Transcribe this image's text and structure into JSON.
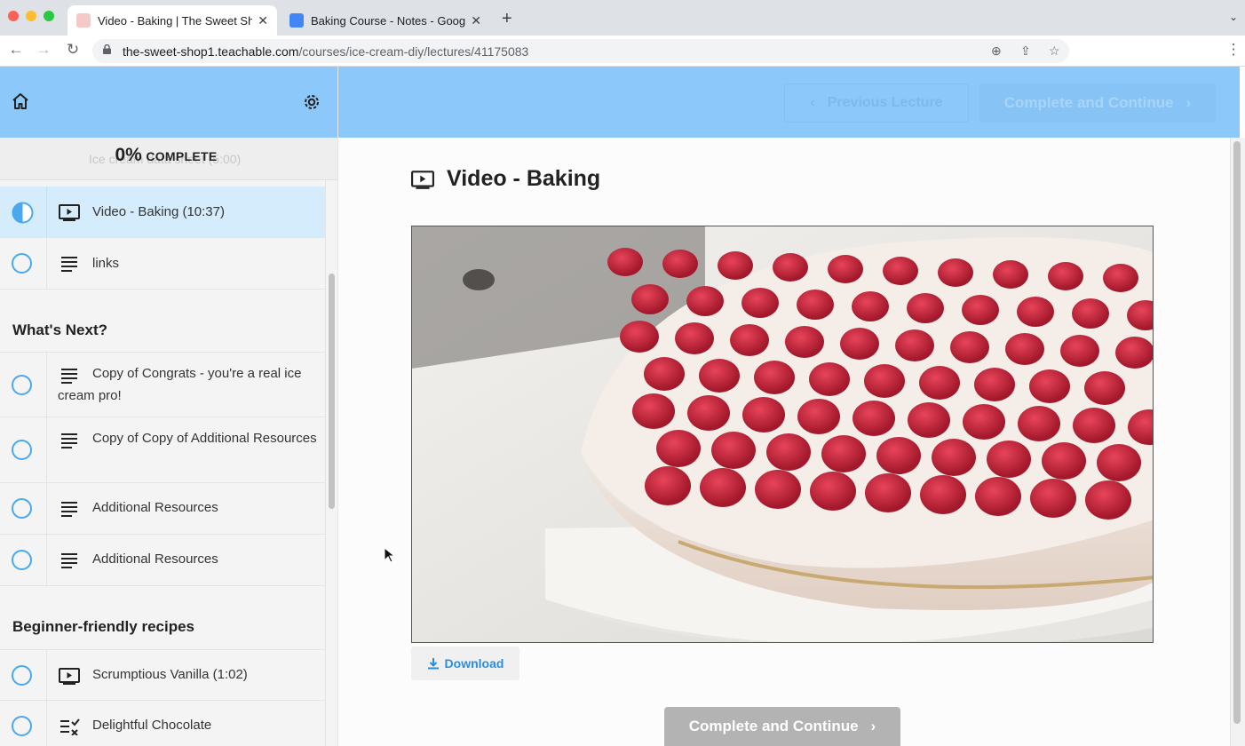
{
  "browser": {
    "tabs": [
      {
        "title": "Video - Baking | The Sweet Sh",
        "active": true
      },
      {
        "title": "Baking Course - Notes - Googl",
        "active": false
      }
    ],
    "url_domain": "the-sweet-shop1.teachable.com",
    "url_path": "/courses/ice-cream-diy/lectures/41175083"
  },
  "sidebar": {
    "progress_percent": "0%",
    "progress_label": "COMPLETE",
    "hidden_item": "Ice cream data sheet (5:00)",
    "items_top": [
      {
        "title": "Video - Baking (10:37)",
        "icon": "video-icon",
        "status": "in-progress"
      },
      {
        "title": "links",
        "icon": "text-icon",
        "status": "incomplete"
      }
    ],
    "section1": {
      "title": "What's Next?",
      "items": [
        {
          "title": "Copy of Congrats - you're a real ice cream pro!",
          "icon": "text-icon"
        },
        {
          "title": "Copy of Copy of Additional Resources",
          "icon": "text-icon"
        },
        {
          "title": "Additional Resources",
          "icon": "text-icon"
        },
        {
          "title": "Additional Resources",
          "icon": "text-icon"
        }
      ]
    },
    "section2": {
      "title": "Beginner-friendly recipes",
      "items": [
        {
          "title": "Scrumptious Vanilla (1:02)",
          "icon": "video-icon"
        },
        {
          "title": "Delightful Chocolate",
          "icon": "quiz-icon"
        }
      ]
    }
  },
  "header": {
    "prev_label": "Previous Lecture",
    "next_label": "Complete and Continue"
  },
  "main": {
    "lecture_title": "Video - Baking",
    "download_label": "Download",
    "complete_label": "Complete and Continue"
  },
  "colors": {
    "accent": "#8dc8fa",
    "active_row": "#d4ecfc",
    "status_ring": "#4ba8ec",
    "link": "#2a8ee0"
  }
}
